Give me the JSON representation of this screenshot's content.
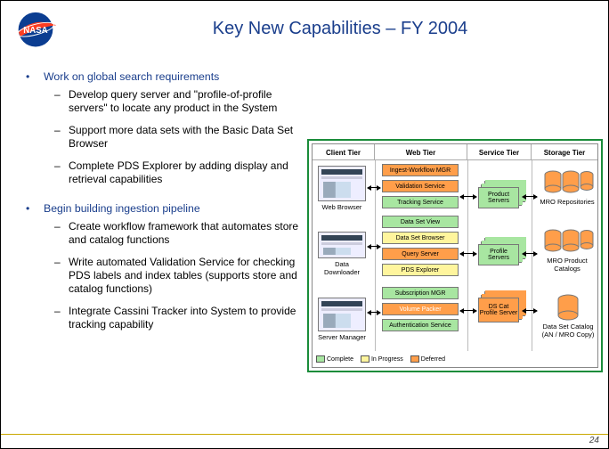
{
  "title": "Key New Capabilities – FY 2004",
  "bullets": [
    {
      "text": "Work on global search requirements",
      "subs": [
        "Develop query server and \"profile-of-profile servers\" to locate any product in the System",
        "Support more data sets with the Basic Data Set Browser",
        "Complete PDS Explorer by adding display and retrieval capabilities"
      ]
    },
    {
      "text": "Begin building ingestion pipeline",
      "subs": [
        "Create workflow framework that automates store and catalog functions",
        "Write automated Validation Service for checking PDS labels and index tables (supports store and catalog functions)",
        "Integrate Cassini Tracker into System to provide tracking capability"
      ]
    }
  ],
  "diagram": {
    "tiers": [
      "Client Tier",
      "Web Tier",
      "Service Tier",
      "Storage Tier"
    ],
    "client": {
      "web_browser": "Web Browser",
      "data_downloader": "Data Downloader",
      "server_manager": "Server Manager"
    },
    "web": {
      "ingest": "Ingest-Workflow MGR",
      "validation": "Validation Service",
      "tracking": "Tracking Service",
      "dsview": "Data Set View",
      "dsbrowser": "Data Set Browser",
      "query": "Query Server",
      "explorer": "PDS Explorer",
      "subscription": "Subscription MGR",
      "volume": "Volume Packer",
      "auth": "Authentication Service"
    },
    "service": {
      "product": "Product Servers",
      "profile": "Profile Servers",
      "dscat": "DS Cat Profile Server"
    },
    "storage": {
      "mro": "MRO Repositories",
      "prodcat": "MRO Product Catalogs",
      "dscat": "Data Set Catalog (AN / MRO Copy)"
    },
    "legend": {
      "complete": "Complete",
      "progress": "In Progress",
      "deferred": "Deferred"
    }
  },
  "page_number": "24"
}
